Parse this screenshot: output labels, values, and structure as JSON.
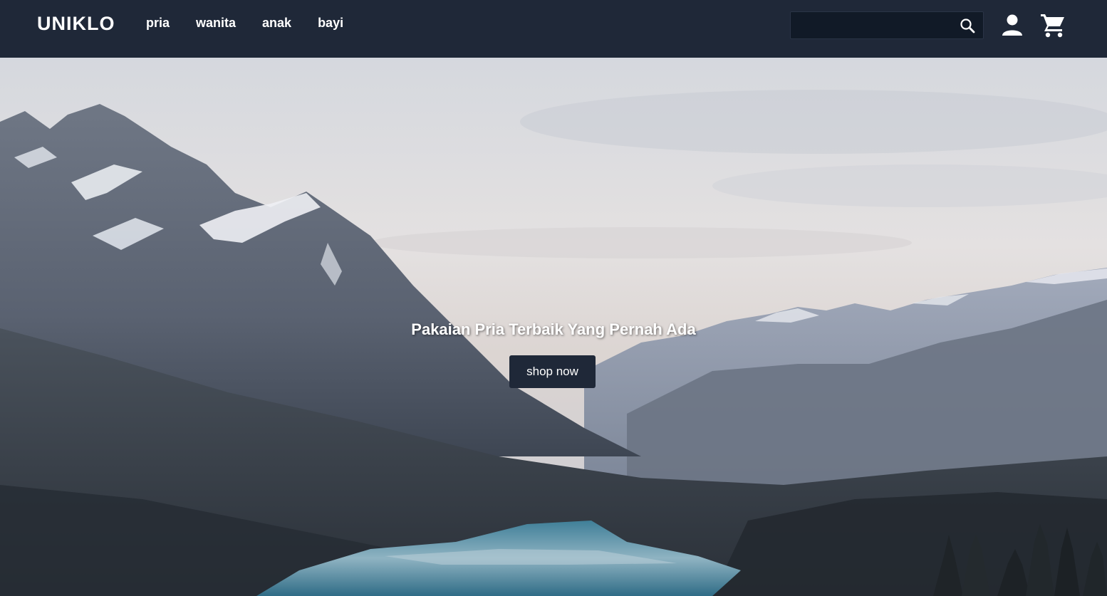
{
  "header": {
    "brand": "UNIKLO",
    "nav": [
      {
        "label": "pria"
      },
      {
        "label": "wanita"
      },
      {
        "label": "anak"
      },
      {
        "label": "bayi"
      }
    ],
    "search": {
      "placeholder": "",
      "value": "",
      "icon": "search-icon"
    },
    "icons": {
      "account": "user-icon",
      "cart": "cart-icon"
    }
  },
  "hero": {
    "title": "Pakaian Pria Terbaik Yang Pernah Ada",
    "cta_label": "shop now",
    "background": "mountain-lake-landscape"
  },
  "colors": {
    "navbar": "#1f2838",
    "button": "#1f2838",
    "text": "#ffffff"
  }
}
